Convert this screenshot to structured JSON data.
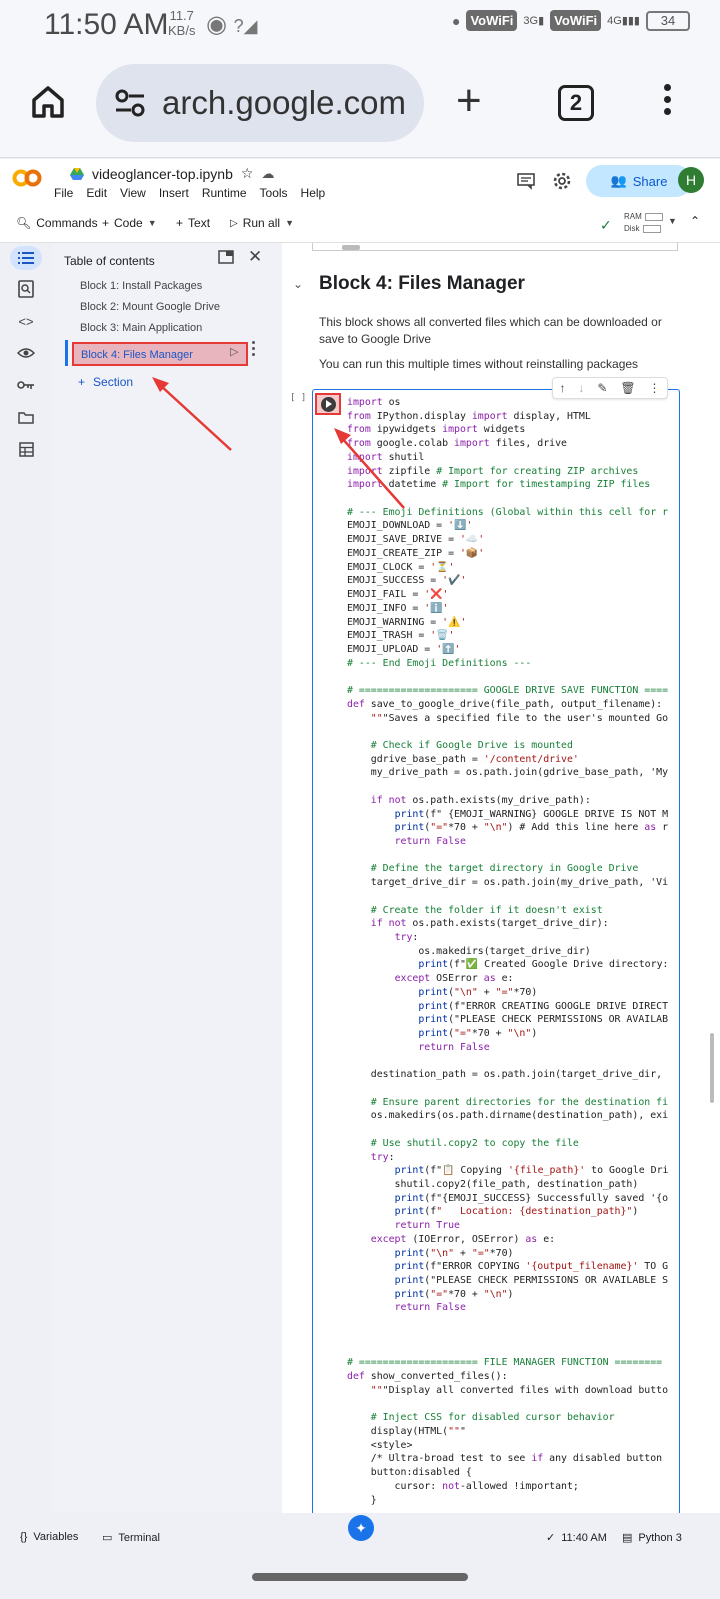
{
  "status_bar": {
    "time": "11:50 AM",
    "speed_value": "11.7",
    "speed_unit": "KB/s",
    "network_label_1": "VoWiFi",
    "network_gen_1": "3G",
    "network_label_2": "VoWiFi",
    "network_gen_2": "4G",
    "battery": "34"
  },
  "browser": {
    "url": "arch.google.com",
    "tab_count": "2"
  },
  "colab": {
    "notebook_name": "videoglancer-top.ipynb",
    "menu": [
      "File",
      "Edit",
      "View",
      "Insert",
      "Runtime",
      "Tools",
      "Help"
    ],
    "share_label": "Share",
    "avatar_initial": "H",
    "brand_color": "#F9AB00"
  },
  "toolbar": {
    "commands": "Commands",
    "code": "Code",
    "text": "Text",
    "run_all": "Run all",
    "ram_label": "RAM",
    "disk_label": "Disk"
  },
  "toc": {
    "title": "Table of contents",
    "items": [
      "Block 1: Install Packages",
      "Block 2: Mount Google Drive",
      "Block 3: Main Application",
      "Block 4: Files Manager"
    ],
    "add_section": "Section"
  },
  "notebook": {
    "heading": "Block 4: Files Manager",
    "para1": "This block shows all converted files which can be downloaded or save to Google Drive",
    "para2": "You can run this multiple times without reinstalling packages",
    "cell_bracket": "[ ]",
    "code_lines": [
      "import os",
      "from IPython.display import display, HTML",
      "from ipywidgets import widgets",
      "from google.colab import files, drive",
      "import shutil",
      "import zipfile # Import for creating ZIP archives",
      "import datetime # Import for timestamping ZIP files",
      "",
      "# --- Emoji Definitions (Global within this cell for r",
      "EMOJI_DOWNLOAD = '⬇️'",
      "EMOJI_SAVE_DRIVE = '☁️'",
      "EMOJI_CREATE_ZIP = '📦'",
      "EMOJI_CLOCK = '⏳'",
      "EMOJI_SUCCESS = '✔️'",
      "EMOJI_FAIL = '❌'",
      "EMOJI_INFO = 'ℹ️'",
      "EMOJI_WARNING = '⚠️'",
      "EMOJI_TRASH = '🗑️'",
      "EMOJI_UPLOAD = '⬆️'",
      "# --- End Emoji Definitions ---",
      "",
      "# ==================== GOOGLE DRIVE SAVE FUNCTION ====",
      "def save_to_google_drive(file_path, output_filename):",
      "    \"\"\"Saves a specified file to the user's mounted Go",
      "",
      "    # Check if Google Drive is mounted",
      "    gdrive_base_path = '/content/drive'",
      "    my_drive_path = os.path.join(gdrive_base_path, 'My",
      "",
      "    if not os.path.exists(my_drive_path):",
      "        print(f\" {EMOJI_WARNING} GOOGLE DRIVE IS NOT M",
      "        print(\"=\"*70 + \"\\n\") # Add this line here as r",
      "        return False",
      "",
      "    # Define the target directory in Google Drive",
      "    target_drive_dir = os.path.join(my_drive_path, 'Vi",
      "",
      "    # Create the folder if it doesn't exist",
      "    if not os.path.exists(target_drive_dir):",
      "        try:",
      "            os.makedirs(target_drive_dir)",
      "            print(f\"✅ Created Google Drive directory:",
      "        except OSError as e:",
      "            print(\"\\n\" + \"=\"*70)",
      "            print(f\"ERROR CREATING GOOGLE DRIVE DIRECT",
      "            print(\"PLEASE CHECK PERMISSIONS OR AVAILAB",
      "            print(\"=\"*70 + \"\\n\")",
      "            return False",
      "",
      "    destination_path = os.path.join(target_drive_dir,",
      "",
      "    # Ensure parent directories for the destination fi",
      "    os.makedirs(os.path.dirname(destination_path), exi",
      "",
      "    # Use shutil.copy2 to copy the file",
      "    try:",
      "        print(f\"📋 Copying '{file_path}' to Google Dri",
      "        shutil.copy2(file_path, destination_path)",
      "        print(f\"{EMOJI_SUCCESS} Successfully saved '{o",
      "        print(f\"   Location: {destination_path}\")",
      "        return True",
      "    except (IOError, OSError) as e:",
      "        print(\"\\n\" + \"=\"*70)",
      "        print(f\"ERROR COPYING '{output_filename}' TO G",
      "        print(\"PLEASE CHECK PERMISSIONS OR AVAILABLE S",
      "        print(\"=\"*70 + \"\\n\")",
      "        return False",
      "",
      "",
      "",
      "# ==================== FILE MANAGER FUNCTION ========",
      "def show_converted_files():",
      "    \"\"\"Display all converted files with download butto",
      "",
      "    # Inject CSS for disabled cursor behavior",
      "    display(HTML(\"\"\"",
      "    <style>",
      "    /* Ultra-broad test to see if any disabled button",
      "    button:disabled {",
      "        cursor: not-allowed !important;",
      "    }"
    ]
  },
  "bottom_bar": {
    "variables": "Variables",
    "terminal": "Terminal",
    "time": "11:40 AM",
    "runtime": "Python 3"
  }
}
